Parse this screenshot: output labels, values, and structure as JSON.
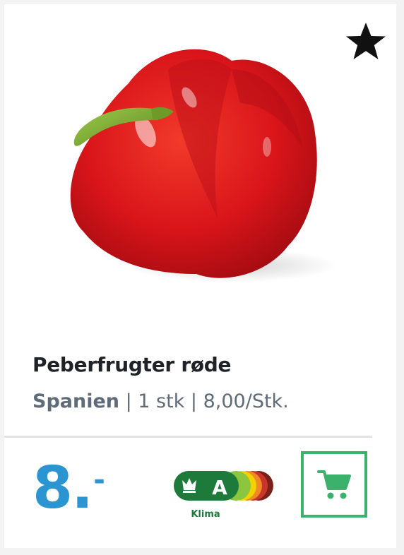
{
  "product": {
    "image_alt": "red bell pepper",
    "name": "Peberfrugter røde",
    "origin": "Spanien",
    "separator": " | ",
    "quantity": "1 stk",
    "unit_price": "8,00/Stk."
  },
  "price": {
    "integer": "8.",
    "decimal": "-"
  },
  "klima_label": {
    "grade": "A",
    "text": "Klima",
    "colors": [
      "#1e7a3a",
      "#8cc63f",
      "#f2d200",
      "#f08a24",
      "#c8352a",
      "#7a1f1a"
    ]
  },
  "icons": {
    "favorite": "star-icon",
    "cart": "cart-icon"
  },
  "colors": {
    "price": "#2a95d1",
    "cart_accent": "#3bb16c"
  }
}
